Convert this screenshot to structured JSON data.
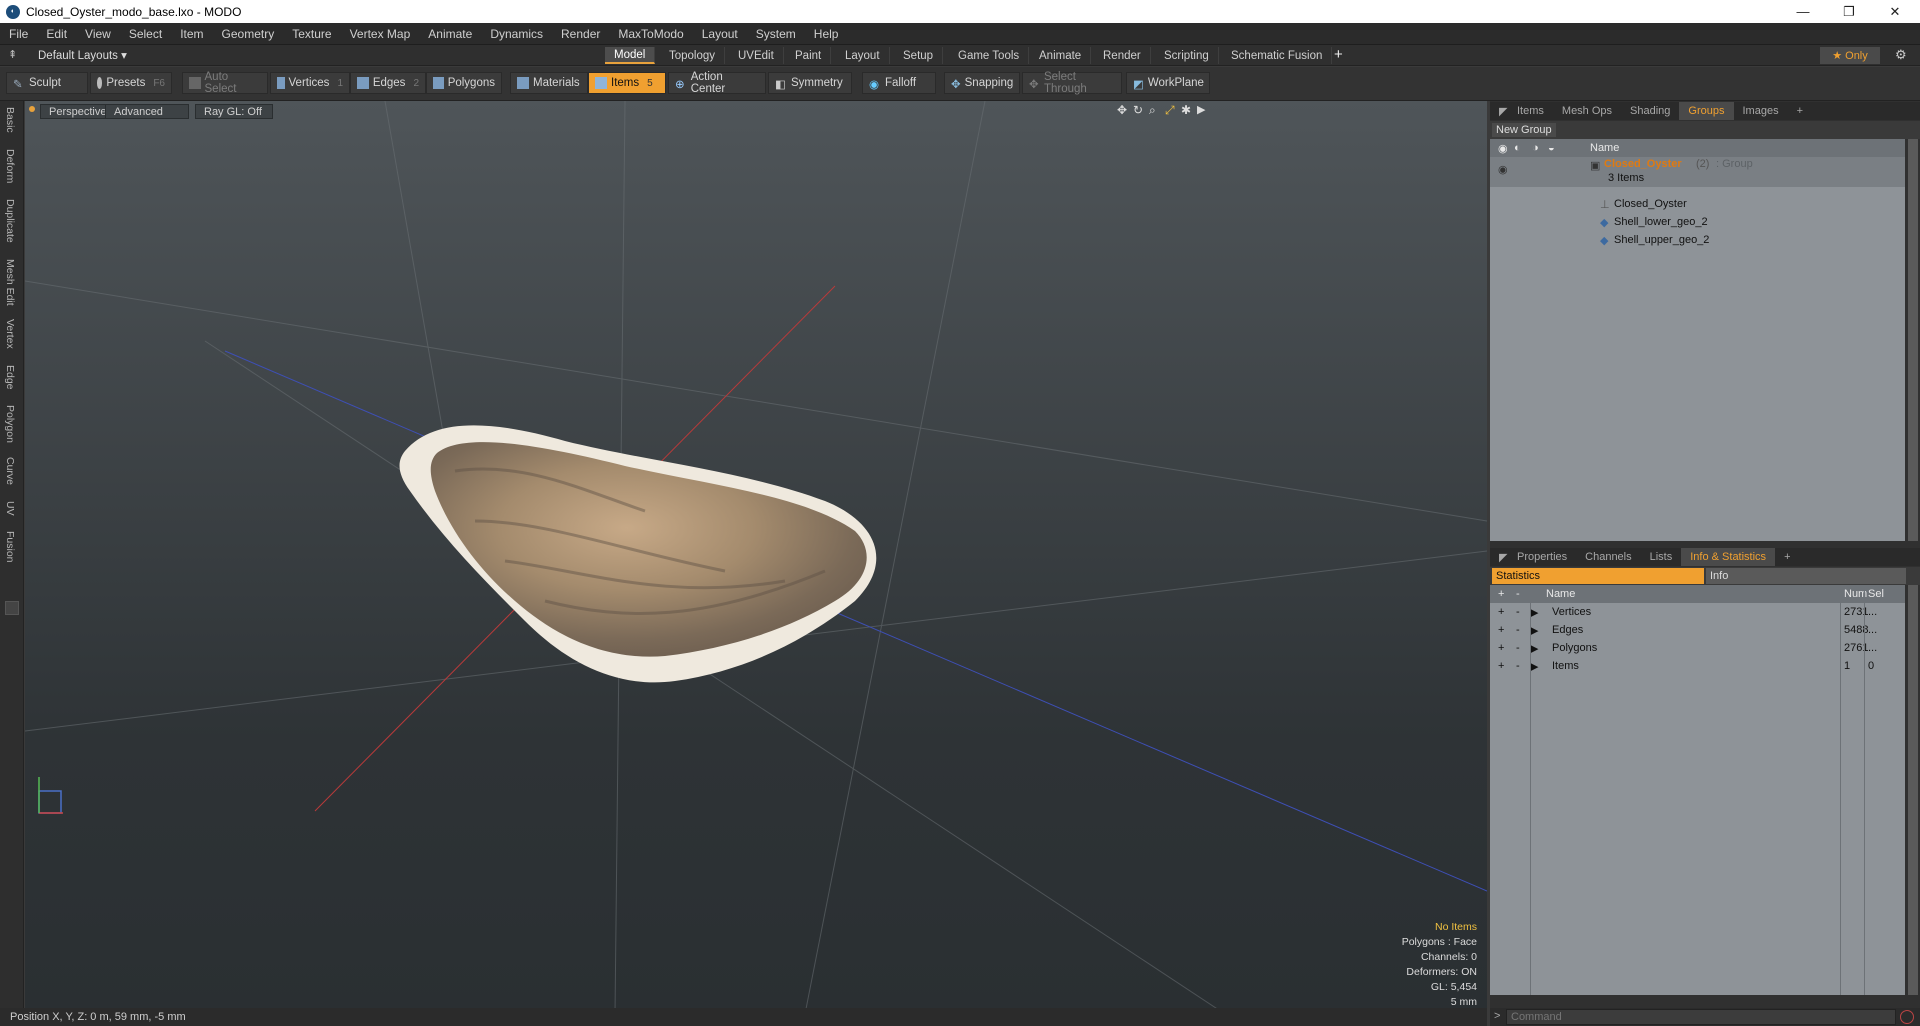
{
  "window": {
    "title": "Closed_Oyster_modo_base.lxo - MODO",
    "minimize": "—",
    "maximize": "❐",
    "close": "✕"
  },
  "menu": [
    "File",
    "Edit",
    "View",
    "Select",
    "Item",
    "Geometry",
    "Texture",
    "Vertex Map",
    "Animate",
    "Dynamics",
    "Render",
    "MaxToModo",
    "Layout",
    "System",
    "Help"
  ],
  "layout_selector": "Default Layouts ▾",
  "layout_tabs": [
    "Model",
    "Topology",
    "UVEdit",
    "Paint",
    "Layout",
    "Setup",
    "Game Tools",
    "Animate",
    "Render",
    "Scripting",
    "Schematic Fusion"
  ],
  "layout_active": "Model",
  "layout_add": "+",
  "only_label": "★ Only",
  "toolbar": {
    "sculpt": "Sculpt",
    "presets": "Presets",
    "presets_key": "F6",
    "auto_select": "Auto Select",
    "vertices": "Vertices",
    "vertices_key": "1",
    "edges": "Edges",
    "edges_key": "2",
    "polygons": "Polygons",
    "materials": "Materials",
    "items": "Items",
    "items_key": "5",
    "action_center": "Action Center",
    "symmetry": "Symmetry",
    "falloff": "Falloff",
    "snapping": "Snapping",
    "select_through": "Select Through",
    "workplane": "WorkPlane"
  },
  "left_tabs": [
    "Basic",
    "Deform",
    "Duplicate",
    "Mesh Edit",
    "Vertex",
    "Edge",
    "Polygon",
    "Curve",
    "UV",
    "Fusion"
  ],
  "viewport": {
    "perspective": "Perspective",
    "advanced": "Advanced",
    "raygl": "Ray GL: Off",
    "info": {
      "items": "No Items",
      "polygons": "Polygons : Face",
      "channels": "Channels: 0",
      "deformers": "Deformers: ON",
      "gl": "GL: 5,454",
      "scale": "5 mm"
    }
  },
  "right_top_tabs": [
    "Items",
    "Mesh Ops",
    "Shading",
    "Groups",
    "Images"
  ],
  "right_top_active": "Groups",
  "new_group": "New Group",
  "tree_header_name": "Name",
  "group": {
    "name": "Closed_Oyster",
    "count": "(2)",
    "type": ": Group",
    "items_count": "3 Items"
  },
  "group_items": [
    "Closed_Oyster",
    "Shell_lower_geo_2",
    "Shell_upper_geo_2"
  ],
  "right_bottom_tabs": [
    "Properties",
    "Channels",
    "Lists",
    "Info & Statistics"
  ],
  "right_bottom_active": "Info & Statistics",
  "stats_tabs": {
    "statistics": "Statistics",
    "info": "Info"
  },
  "stats_header": {
    "name": "Name",
    "num": "Num",
    "sel": "Sel"
  },
  "stats_rows": [
    {
      "name": "Vertices",
      "num": "2731",
      "sel": "..."
    },
    {
      "name": "Edges",
      "num": "5488",
      "sel": "..."
    },
    {
      "name": "Polygons",
      "num": "2761",
      "sel": "..."
    },
    {
      "name": "Items",
      "num": "1",
      "sel": "0"
    }
  ],
  "status_position": "Position X, Y, Z:   0 m, 59 mm, -5 mm",
  "command_placeholder": "Command",
  "colors": {
    "accent": "#f0a030",
    "panel": "#8e9398",
    "group_name": "#e07a10"
  }
}
